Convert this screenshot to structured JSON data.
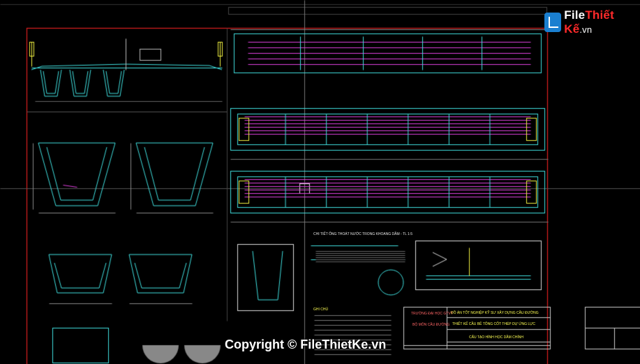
{
  "branding": {
    "logo_part1": "File",
    "logo_part2": "Thiết Kế",
    "logo_part3": ".vn",
    "copyright": "Copyright © FileThietKe.vn"
  },
  "title_block": {
    "project": "ĐỒ ÁN TỐT NGHIỆP KỸ SƯ XÂY DỰNG CẦU ĐƯỜNG",
    "subject": "THIẾT KẾ CẦU BÊ TÔNG CỐT THÉP DỰ ỨNG LỰC",
    "drawing": "CẤU TẠO HÌNH HỌC DẦM CHÍNH",
    "school": "TRƯỜNG ĐẠI HỌC GTVT",
    "dept": "BỘ MÔN CẦU ĐƯỜNG"
  },
  "sheet_labels": {
    "section_details": "CHI TIẾT ỐNG THOÁT NƯỚC TRONG KHOANG DẦM - TL 1:5",
    "notes_title": "GHI CHÚ"
  },
  "colors": {
    "background": "#000000",
    "frame": "#e02020",
    "cyan": "#40e0e0",
    "magenta": "#e040e0",
    "yellow": "#f0f040",
    "white": "#e8e8e8"
  }
}
